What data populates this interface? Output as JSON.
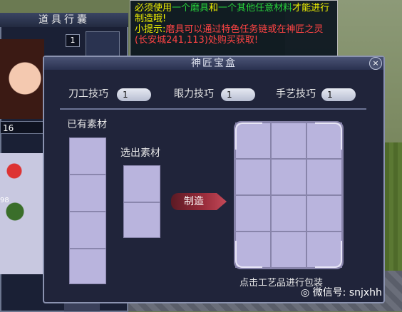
{
  "inventory": {
    "title": "道具行囊",
    "count": "1",
    "level": "16",
    "stack": "98"
  },
  "tooltip": {
    "line1_prefix": "必须使用",
    "item1": "一个磨具",
    "and": "和",
    "item2": "一个其他任意材料",
    "line1_suffix": "才能进行制造哦!",
    "hint_label": "小提示:",
    "hint_body": "磨具可以通过特色任务链或在神匠之灵(长安城241,113)处购买获取!"
  },
  "dialog": {
    "title": "神匠宝盒",
    "close_label": "×",
    "skills": [
      {
        "label": "刀工技巧",
        "value": "1"
      },
      {
        "label": "眼力技巧",
        "value": "1"
      },
      {
        "label": "手艺技巧",
        "value": "1"
      }
    ],
    "owned_materials_label": "已有素材",
    "selected_materials_label": "选出素材",
    "craft_button": "制造",
    "pack_hint": "点击工艺品进行包装"
  },
  "watermark": "微信号: snjxhh",
  "colors": {
    "tooltip_yellow": "#f0f000",
    "tooltip_green": "#27d13a",
    "tooltip_red": "#ff4444",
    "slot_lavender": "#b9b4dd",
    "craft_button_red": "#9b2d3c"
  }
}
